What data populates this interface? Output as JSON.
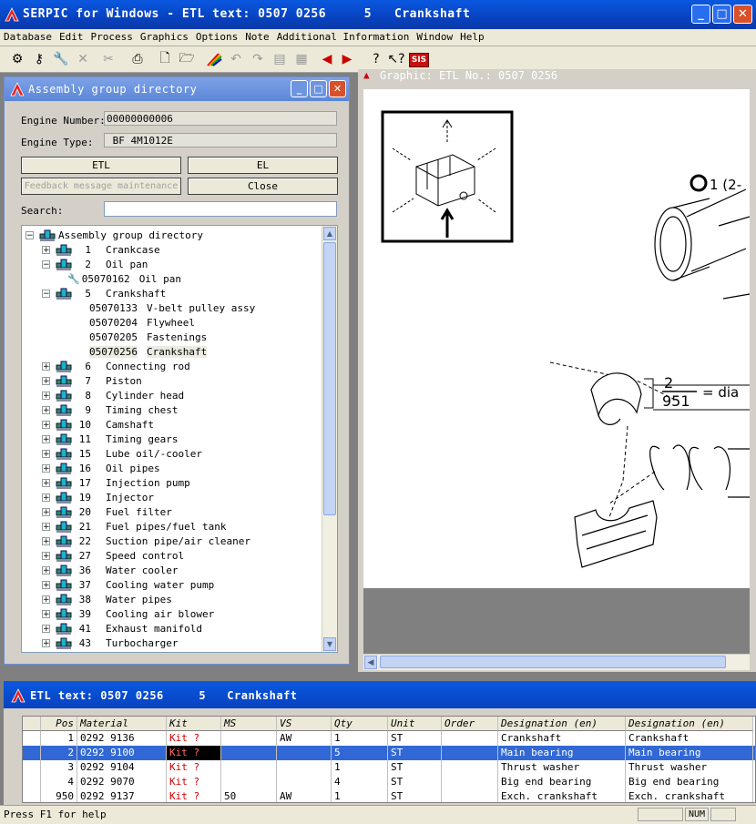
{
  "window": {
    "title": "SERPIC for Windows - ETL text: 0507 0256     5   Crankshaft"
  },
  "menu": [
    "Database",
    "Edit",
    "Process",
    "Graphics",
    "Options",
    "Note",
    "Additional Information",
    "Window",
    "Help"
  ],
  "assembly": {
    "title": "Assembly group directory",
    "engine_number_label": "Engine Number:",
    "engine_number": "00000000006",
    "engine_type_label": "Engine Type:",
    "engine_type": " BF 4M1012E",
    "btn_etl": "ETL",
    "btn_el": "EL",
    "btn_feedback": "Feedback message maintenance",
    "btn_close": "Close",
    "search_label": "Search:",
    "search_value": "",
    "tree_root": "Assembly group directory",
    "groups_top": [
      {
        "num": "1",
        "label": "Crankcase",
        "expanded": false
      },
      {
        "num": "2",
        "label": "Oil pan",
        "expanded": true
      }
    ],
    "oil_pan_child": {
      "code": "05070162",
      "label": "Oil pan"
    },
    "crankshaft": {
      "num": "5",
      "label": "Crankshaft"
    },
    "crankshaft_children": [
      {
        "code": "05070133",
        "label": "V-belt pulley assy"
      },
      {
        "code": "05070204",
        "label": "Flywheel"
      },
      {
        "code": "05070205",
        "label": "Fastenings"
      },
      {
        "code": "05070256",
        "label": "Crankshaft"
      }
    ],
    "groups_bottom": [
      {
        "num": "6",
        "label": "Connecting rod"
      },
      {
        "num": "7",
        "label": "Piston"
      },
      {
        "num": "8",
        "label": "Cylinder head"
      },
      {
        "num": "9",
        "label": "Timing chest"
      },
      {
        "num": "10",
        "label": "Camshaft"
      },
      {
        "num": "11",
        "label": "Timing gears"
      },
      {
        "num": "15",
        "label": "Lube oil/-cooler"
      },
      {
        "num": "16",
        "label": "Oil pipes"
      },
      {
        "num": "17",
        "label": "Injection pump"
      },
      {
        "num": "19",
        "label": "Injector"
      },
      {
        "num": "20",
        "label": "Fuel filter"
      },
      {
        "num": "21",
        "label": "Fuel pipes/fuel tank"
      },
      {
        "num": "22",
        "label": "Suction pipe/air cleaner"
      },
      {
        "num": "27",
        "label": "Speed control"
      },
      {
        "num": "36",
        "label": "Water cooler"
      },
      {
        "num": "37",
        "label": "Cooling water pump"
      },
      {
        "num": "38",
        "label": "Water pipes"
      },
      {
        "num": "39",
        "label": "Cooling air blower"
      },
      {
        "num": "41",
        "label": "Exhaust manifold"
      },
      {
        "num": "43",
        "label": "Turbocharger"
      }
    ]
  },
  "graphic": {
    "title": "Graphic: ETL No.: 0507 0256",
    "callout_1": "1 (2-",
    "frac_num": "2",
    "frac_den": "951",
    "frac_text": "= dia"
  },
  "etl": {
    "title": "ETL text: 0507 0256     5   Crankshaft",
    "columns": [
      "",
      "Pos",
      "Material",
      "Kit",
      "MS",
      "VS",
      "Qty",
      "Unit",
      "Order",
      "Designation (en)",
      "Designation (en)"
    ],
    "rows": [
      {
        "pos": "1",
        "material": "0292 9136",
        "kit": "Kit ?",
        "ms": "",
        "vs": "AW",
        "qty": "1",
        "unit": "ST",
        "order": "",
        "des1": "Crankshaft",
        "des2": "Crankshaft"
      },
      {
        "pos": "2",
        "material": "0292 9100",
        "kit": "Kit ?",
        "ms": "",
        "vs": "",
        "qty": "5",
        "unit": "ST",
        "order": "",
        "des1": "Main bearing",
        "des2": "Main bearing"
      },
      {
        "pos": "3",
        "material": "0292 9104",
        "kit": "Kit ?",
        "ms": "",
        "vs": "",
        "qty": "1",
        "unit": "ST",
        "order": "",
        "des1": "Thrust washer",
        "des2": "Thrust washer"
      },
      {
        "pos": "4",
        "material": "0292 9070",
        "kit": "Kit ?",
        "ms": "",
        "vs": "",
        "qty": "4",
        "unit": "ST",
        "order": "",
        "des1": "Big end bearing",
        "des2": "Big end bearing"
      },
      {
        "pos": "950",
        "material": "0292 9137",
        "kit": "Kit ?",
        "ms": "50",
        "vs": "AW",
        "qty": "1",
        "unit": "ST",
        "order": "",
        "des1": "Exch. crankshaft",
        "des2": "Exch. crankshaft"
      }
    ]
  },
  "status": {
    "message": "Press F1 for help",
    "num": "NUM"
  }
}
